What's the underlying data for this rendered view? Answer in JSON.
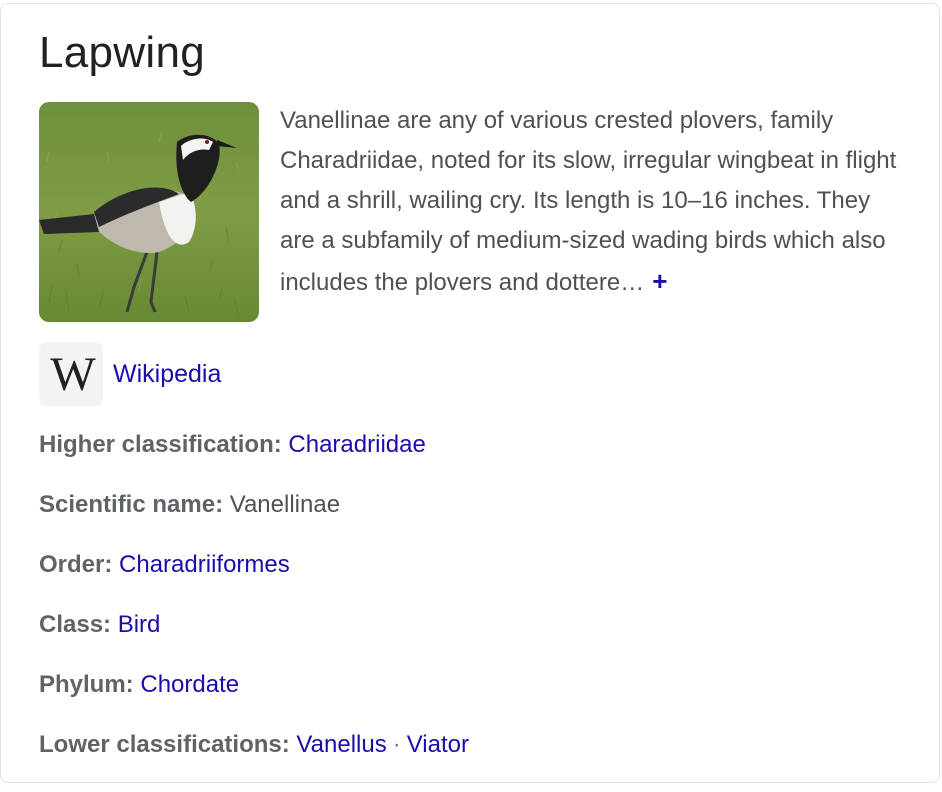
{
  "panel": {
    "title": "Lapwing",
    "description": "Vanellinae are any of various crested plovers, family Charadriidae, noted for its slow, irregular wingbeat in flight and a shrill, wailing cry. Its length is 10–16 inches. They are a subfamily of medium-sized wading birds which also includes the plovers and dottere…",
    "more_symbol": "+",
    "image_alt": "Lapwing bird standing on grass",
    "source": {
      "logo_letter": "W",
      "label": "Wikipedia"
    },
    "facts": {
      "higher_classification": {
        "label": "Higher classification:",
        "value": "Charadriidae"
      },
      "scientific_name": {
        "label": "Scientific name:",
        "value": "Vanellinae"
      },
      "order": {
        "label": "Order:",
        "value": "Charadriiformes"
      },
      "class": {
        "label": "Class:",
        "value": "Bird"
      },
      "phylum": {
        "label": "Phylum:",
        "value": "Chordate"
      },
      "lower_classifications": {
        "label": "Lower classifications:",
        "values": [
          "Vanellus",
          "Viator"
        ],
        "separator": "·"
      }
    }
  },
  "colors": {
    "link": "#1a0dab",
    "text": "#4d5156",
    "title": "#202124",
    "border": "#dfe1e5"
  }
}
